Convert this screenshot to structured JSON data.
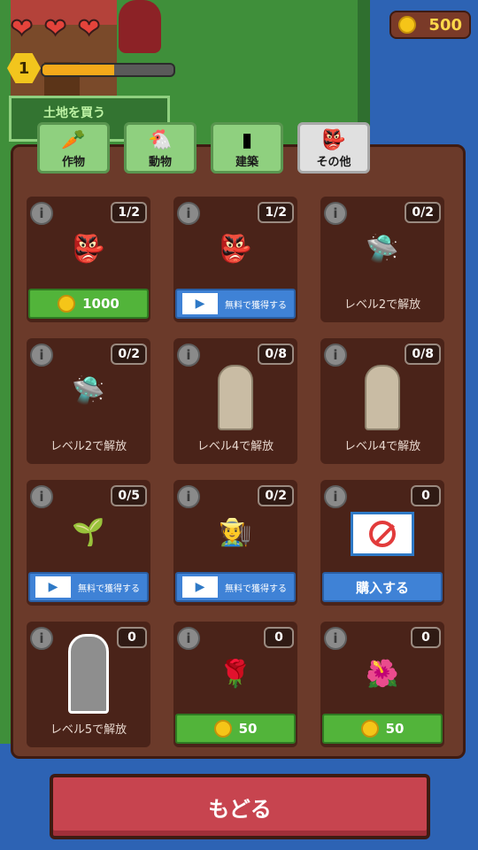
{
  "hud": {
    "level": "1",
    "xp_fraction": 0.55,
    "coins": "500",
    "hearts": 3,
    "buy_land_label": "土地を買う"
  },
  "tabs": [
    {
      "label": "作物",
      "icon": "crop-icon",
      "active": false
    },
    {
      "label": "動物",
      "icon": "chicken-icon",
      "active": false
    },
    {
      "label": "建築",
      "icon": "building-icon",
      "active": false
    },
    {
      "label": "その他",
      "icon": "goblin-icon",
      "active": true
    }
  ],
  "items": [
    {
      "count": "1/2",
      "sprite": "goblin",
      "action": "coin",
      "action_label": "1000"
    },
    {
      "count": "1/2",
      "sprite": "goblin",
      "action": "video",
      "action_label": "無料で獲得する"
    },
    {
      "count": "0/2",
      "sprite": "drone",
      "action": "lock",
      "action_label": "レベル2で解放"
    },
    {
      "count": "0/2",
      "sprite": "drone",
      "action": "lock",
      "action_label": "レベル2で解放"
    },
    {
      "count": "0/8",
      "sprite": "statue",
      "action": "lock",
      "action_label": "レベル4で解放"
    },
    {
      "count": "0/8",
      "sprite": "statue",
      "action": "lock",
      "action_label": "レベル4で解放"
    },
    {
      "count": "0/5",
      "sprite": "sprout",
      "action": "video",
      "action_label": "無料で獲得する"
    },
    {
      "count": "0/2",
      "sprite": "scarecrow",
      "action": "video",
      "action_label": "無料で獲得する"
    },
    {
      "count": "0",
      "sprite": "no-ads",
      "action": "buy",
      "action_label": "購入する"
    },
    {
      "count": "0",
      "sprite": "gravestone",
      "action": "lock",
      "action_label": "レベル5で解放"
    },
    {
      "count": "0",
      "sprite": "red-flower",
      "action": "coin",
      "action_label": "50"
    },
    {
      "count": "0",
      "sprite": "bird-of-paradise",
      "action": "coin",
      "action_label": "50"
    }
  ],
  "info_symbol": "i",
  "back_label": "もどる"
}
